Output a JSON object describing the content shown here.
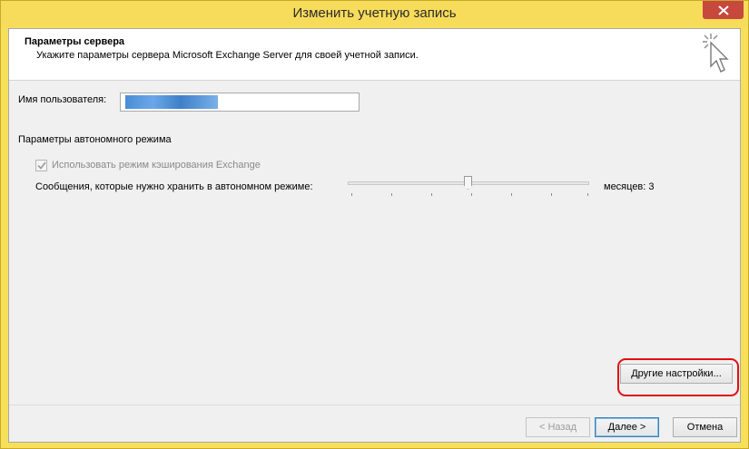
{
  "window": {
    "title": "Изменить учетную запись"
  },
  "header": {
    "title": "Параметры сервера",
    "subtitle": "Укажите параметры сервера Microsoft Exchange Server для своей учетной записи."
  },
  "form": {
    "username_label": "Имя пользователя:",
    "username_value": "",
    "offline_section_label": "Параметры автономного режима",
    "cached_mode_label": "Использовать режим кэширования Exchange",
    "cached_mode_checked": true,
    "cached_mode_enabled": false,
    "keep_offline_label": "Сообщения, которые нужно хранить в автономном режиме:",
    "keep_offline_value": "месяцев: 3"
  },
  "buttons": {
    "more_settings": "Другие настройки...",
    "back": "< Назад",
    "next": "Далее >",
    "cancel": "Отмена"
  },
  "colors": {
    "titlebar": "#f7db5b",
    "close_button": "#c7483d",
    "highlight_ring": "#e01010"
  },
  "icons": {
    "close": "close-icon",
    "wizard": "wizard-cursor-icon",
    "checkmark": "checkmark-icon"
  }
}
